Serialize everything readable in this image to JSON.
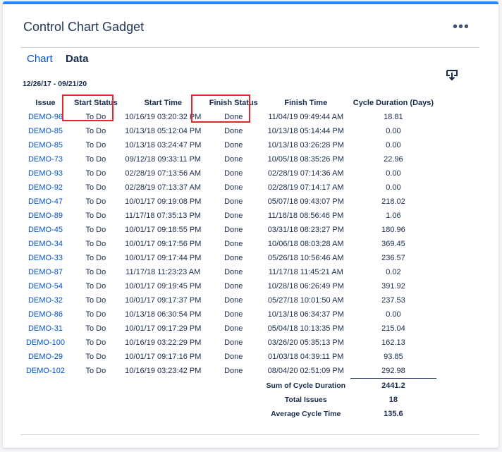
{
  "gadget": {
    "title": "Control Chart Gadget",
    "menu_icon": "more-horizontal-icon"
  },
  "tabs": [
    {
      "label": "Chart",
      "active": false
    },
    {
      "label": "Data",
      "active": true
    }
  ],
  "date_range": "12/26/17 - 09/21/20",
  "download_icon": "download-icon",
  "table": {
    "headers": {
      "issue": "Issue",
      "start_status": "Start Status",
      "start_time": "Start Time",
      "finish_status": "Finish Status",
      "finish_time": "Finish Time",
      "cycle_duration": "Cycle Duration (Days)"
    },
    "rows": [
      {
        "issue": "DEMO-96",
        "start_status": "To Do",
        "start_time": "10/16/19 03:20:32 PM",
        "finish_status": "Done",
        "finish_time": "11/04/19 09:49:44 AM",
        "cycle": "18.81"
      },
      {
        "issue": "DEMO-85",
        "start_status": "To Do",
        "start_time": "10/13/18 05:12:04 PM",
        "finish_status": "Done",
        "finish_time": "10/13/18 05:14:44 PM",
        "cycle": "0.00"
      },
      {
        "issue": "DEMO-85",
        "start_status": "To Do",
        "start_time": "10/13/18 03:24:47 PM",
        "finish_status": "Done",
        "finish_time": "10/13/18 03:26:28 PM",
        "cycle": "0.00"
      },
      {
        "issue": "DEMO-73",
        "start_status": "To Do",
        "start_time": "09/12/18 09:33:11 PM",
        "finish_status": "Done",
        "finish_time": "10/05/18 08:35:26 PM",
        "cycle": "22.96"
      },
      {
        "issue": "DEMO-93",
        "start_status": "To Do",
        "start_time": "02/28/19 07:13:56 AM",
        "finish_status": "Done",
        "finish_time": "02/28/19 07:14:36 AM",
        "cycle": "0.00"
      },
      {
        "issue": "DEMO-92",
        "start_status": "To Do",
        "start_time": "02/28/19 07:13:37 AM",
        "finish_status": "Done",
        "finish_time": "02/28/19 07:14:17 AM",
        "cycle": "0.00"
      },
      {
        "issue": "DEMO-47",
        "start_status": "To Do",
        "start_time": "10/01/17 09:19:08 PM",
        "finish_status": "Done",
        "finish_time": "05/07/18 09:43:07 PM",
        "cycle": "218.02"
      },
      {
        "issue": "DEMO-89",
        "start_status": "To Do",
        "start_time": "11/17/18 07:35:13 PM",
        "finish_status": "Done",
        "finish_time": "11/18/18 08:56:46 PM",
        "cycle": "1.06"
      },
      {
        "issue": "DEMO-45",
        "start_status": "To Do",
        "start_time": "10/01/17 09:18:55 PM",
        "finish_status": "Done",
        "finish_time": "03/31/18 08:23:27 PM",
        "cycle": "180.96"
      },
      {
        "issue": "DEMO-34",
        "start_status": "To Do",
        "start_time": "10/01/17 09:17:56 PM",
        "finish_status": "Done",
        "finish_time": "10/06/18 08:03:28 AM",
        "cycle": "369.45"
      },
      {
        "issue": "DEMO-33",
        "start_status": "To Do",
        "start_time": "10/01/17 09:17:44 PM",
        "finish_status": "Done",
        "finish_time": "05/26/18 10:56:46 AM",
        "cycle": "236.57"
      },
      {
        "issue": "DEMO-87",
        "start_status": "To Do",
        "start_time": "11/17/18 11:23:23 AM",
        "finish_status": "Done",
        "finish_time": "11/17/18 11:45:21 AM",
        "cycle": "0.02"
      },
      {
        "issue": "DEMO-54",
        "start_status": "To Do",
        "start_time": "10/01/17 09:19:45 PM",
        "finish_status": "Done",
        "finish_time": "10/28/18 06:26:49 PM",
        "cycle": "391.92"
      },
      {
        "issue": "DEMO-32",
        "start_status": "To Do",
        "start_time": "10/01/17 09:17:37 PM",
        "finish_status": "Done",
        "finish_time": "05/27/18 10:01:50 AM",
        "cycle": "237.53"
      },
      {
        "issue": "DEMO-86",
        "start_status": "To Do",
        "start_time": "10/13/18 06:30:54 PM",
        "finish_status": "Done",
        "finish_time": "10/13/18 06:34:37 PM",
        "cycle": "0.00"
      },
      {
        "issue": "DEMO-31",
        "start_status": "To Do",
        "start_time": "10/01/17 09:17:29 PM",
        "finish_status": "Done",
        "finish_time": "05/04/18 10:13:35 PM",
        "cycle": "215.04"
      },
      {
        "issue": "DEMO-100",
        "start_status": "To Do",
        "start_time": "10/16/19 03:22:29 PM",
        "finish_status": "Done",
        "finish_time": "03/26/20 05:35:13 PM",
        "cycle": "162.13"
      },
      {
        "issue": "DEMO-29",
        "start_status": "To Do",
        "start_time": "10/01/17 09:17:16 PM",
        "finish_status": "Done",
        "finish_time": "01/03/18 04:39:11 PM",
        "cycle": "93.85"
      },
      {
        "issue": "DEMO-102",
        "start_status": "To Do",
        "start_time": "10/16/19 03:23:42 PM",
        "finish_status": "Done",
        "finish_time": "08/04/20 02:51:09 PM",
        "cycle": "292.98"
      }
    ],
    "summary": [
      {
        "label": "Sum of Cycle Duration",
        "value": "2441.2"
      },
      {
        "label": "Total Issues",
        "value": "18"
      },
      {
        "label": "Average Cycle Time",
        "value": "135.6"
      }
    ]
  },
  "colors": {
    "accent": "#2684ff",
    "link": "#0052cc",
    "highlight": "#e5262a"
  }
}
